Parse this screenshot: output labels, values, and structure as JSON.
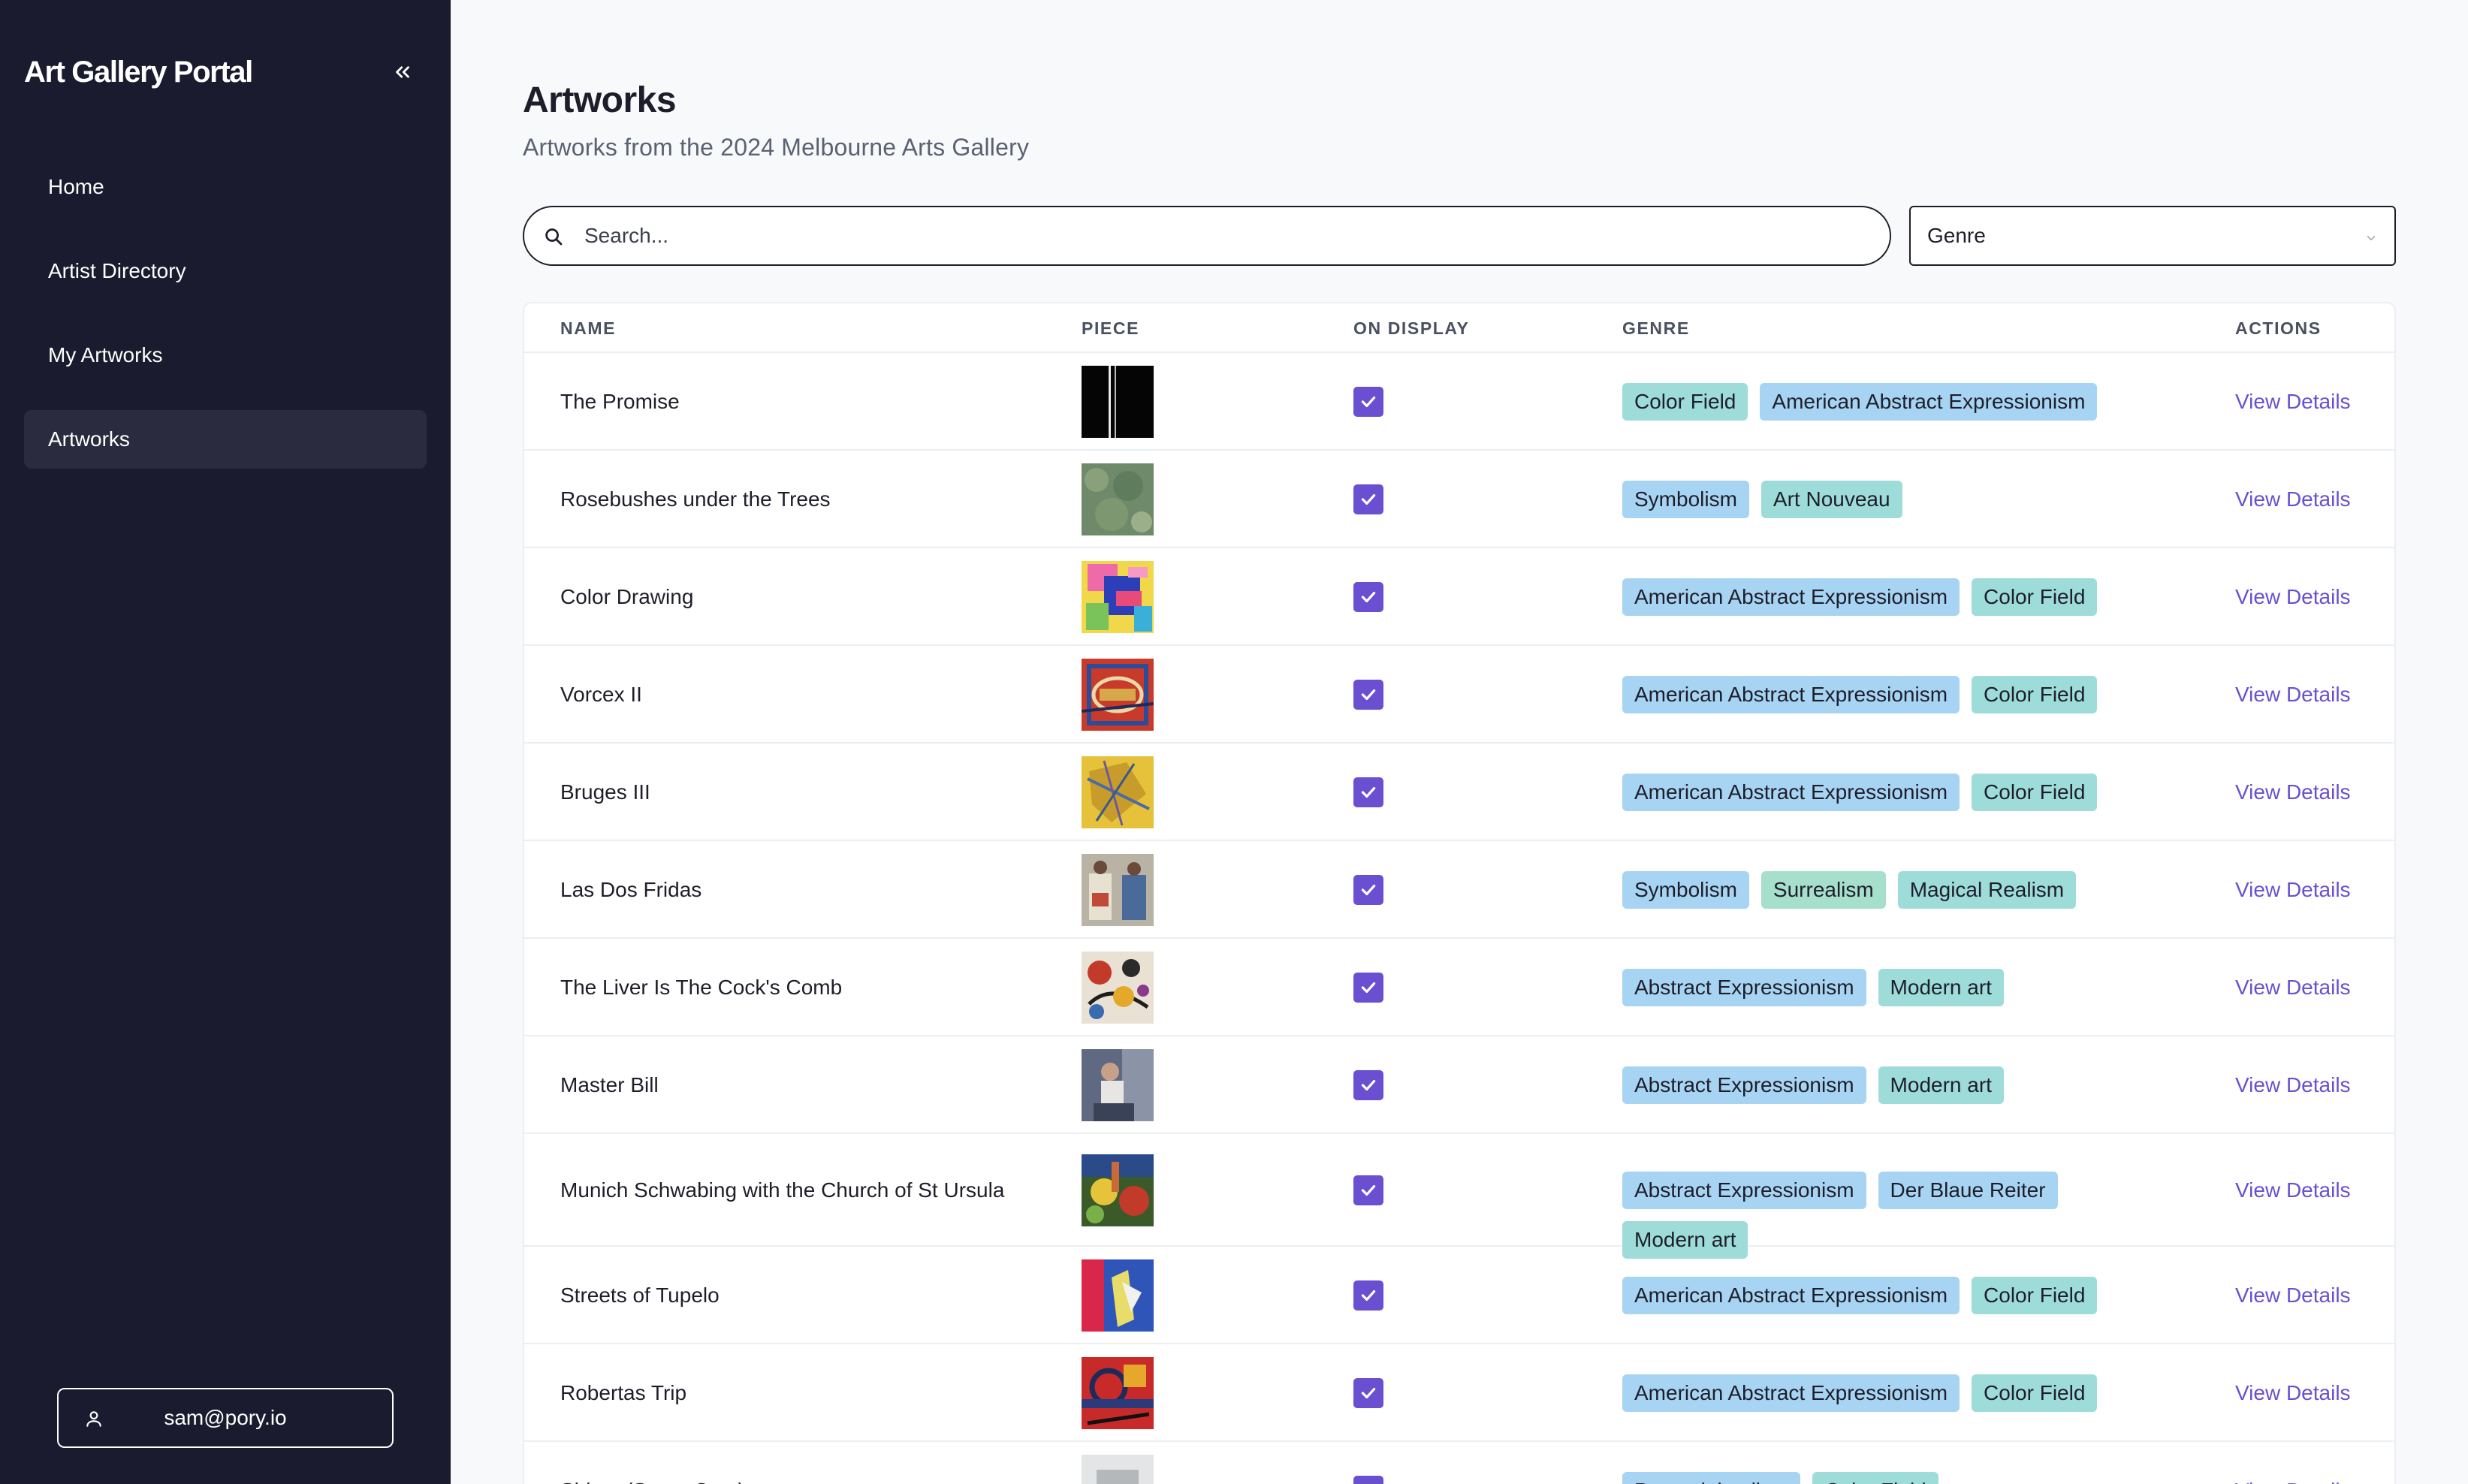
{
  "app": {
    "title": "Art Gallery Portal"
  },
  "sidebar": {
    "items": [
      {
        "label": "Home"
      },
      {
        "label": "Artist Directory"
      },
      {
        "label": "My Artworks"
      },
      {
        "label": "Artworks"
      }
    ],
    "active": "Artworks",
    "user_email": "sam@pory.io"
  },
  "page": {
    "title": "Artworks",
    "subtitle": "Artworks from the 2024 Melbourne Arts Gallery"
  },
  "search": {
    "placeholder": "Search..."
  },
  "filter": {
    "genre_label": "Genre"
  },
  "table": {
    "headers": {
      "name": "NAME",
      "piece": "PIECE",
      "on_display": "ON DISPLAY",
      "genre": "GENRE",
      "actions": "ACTIONS"
    },
    "action_label": "View Details",
    "rows": [
      {
        "name": "The Promise",
        "on_display": true,
        "genres": [
          "Color Field",
          "American Abstract Expressionism"
        ]
      },
      {
        "name": "Rosebushes under the Trees",
        "on_display": true,
        "genres": [
          "Symbolism",
          "Art Nouveau"
        ]
      },
      {
        "name": "Color Drawing",
        "on_display": true,
        "genres": [
          "American Abstract Expressionism",
          "Color Field"
        ]
      },
      {
        "name": "Vorcex II",
        "on_display": true,
        "genres": [
          "American Abstract Expressionism",
          "Color Field"
        ]
      },
      {
        "name": "Bruges III",
        "on_display": true,
        "genres": [
          "American Abstract Expressionism",
          "Color Field"
        ]
      },
      {
        "name": "Las Dos Fridas",
        "on_display": true,
        "genres": [
          "Symbolism",
          "Surrealism",
          "Magical Realism"
        ]
      },
      {
        "name": "The Liver Is The Cock's Comb",
        "on_display": true,
        "genres": [
          "Abstract Expressionism",
          "Modern art"
        ]
      },
      {
        "name": "Master Bill",
        "on_display": true,
        "genres": [
          "Abstract Expressionism",
          "Modern art"
        ]
      },
      {
        "name": "Munich Schwabing with the Church of St Ursula",
        "on_display": true,
        "genres": [
          "Abstract Expressionism",
          "Der Blaue Reiter",
          "Modern art"
        ]
      },
      {
        "name": "Streets of Tupelo",
        "on_display": true,
        "genres": [
          "American Abstract Expressionism",
          "Color Field"
        ]
      },
      {
        "name": "Robertas Trip",
        "on_display": true,
        "genres": [
          "American Abstract Expressionism",
          "Color Field"
        ]
      },
      {
        "name": "Shiraz (Santa Cruz)",
        "on_display": true,
        "genres": [
          "Post-minimalism",
          "Color Field"
        ]
      }
    ]
  },
  "colors": {
    "sidebar_bg": "#1a1b2f",
    "accent": "#6a4fd1",
    "tag_blue": "#a7d4f2",
    "tag_teal": "#9ddcd9",
    "tag_green": "#a6e0cd"
  }
}
